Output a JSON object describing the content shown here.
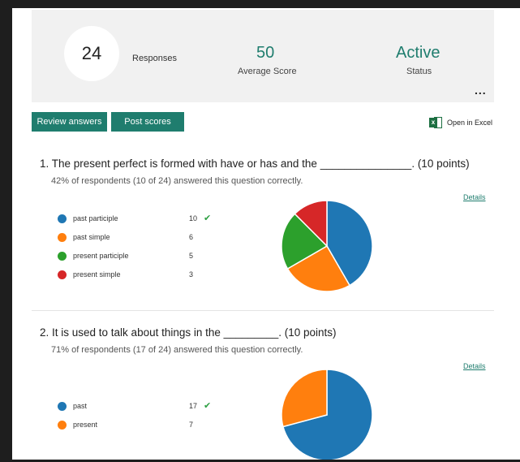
{
  "summary": {
    "responses_count": "24",
    "responses_label": "Responses",
    "average_score": "50",
    "average_score_label": "Average Score",
    "status": "Active",
    "status_label": "Status",
    "more_label": "..."
  },
  "toolbar": {
    "review_label": "Review answers",
    "post_label": "Post scores",
    "excel_label": "Open in Excel"
  },
  "questions": [
    {
      "title": "1. The present perfect is formed with have or has and the _______________. (10 points)",
      "subtitle": "42% of respondents (10 of 24) answered this question correctly.",
      "details_label": "Details",
      "options": [
        {
          "label": "past participle",
          "count": "10",
          "correct": true,
          "color": "#1f77b4"
        },
        {
          "label": "past simple",
          "count": "6",
          "correct": false,
          "color": "#ff7f0e"
        },
        {
          "label": "present participle",
          "count": "5",
          "correct": false,
          "color": "#2ca02c"
        },
        {
          "label": "present simple",
          "count": "3",
          "correct": false,
          "color": "#d62728"
        }
      ]
    },
    {
      "title": "2. It is used to talk about things in the _________. (10 points)",
      "subtitle": "71% of respondents (17 of 24) answered this question correctly.",
      "details_label": "Details",
      "options": [
        {
          "label": "past",
          "count": "17",
          "correct": true,
          "color": "#1f77b4"
        },
        {
          "label": "present",
          "count": "7",
          "correct": false,
          "color": "#ff7f0e"
        }
      ]
    }
  ],
  "check_glyph": "✔",
  "icons": {
    "excel": "excel-icon",
    "more": "more-icon",
    "check": "check-icon"
  }
}
